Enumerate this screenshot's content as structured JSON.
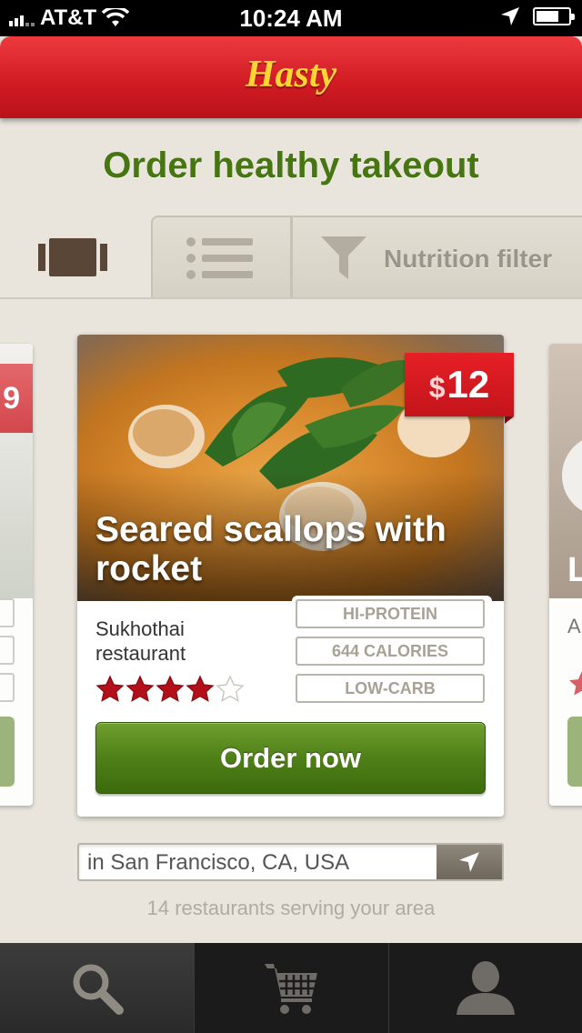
{
  "status_bar": {
    "carrier": "AT&T",
    "time": "10:24 AM"
  },
  "header": {
    "logo": "Hasty"
  },
  "headline": "Order healthy takeout",
  "view_tabs": {
    "filter_label": "Nutrition filter",
    "icons": [
      "card-view-icon",
      "list-view-icon",
      "funnel-icon"
    ]
  },
  "left_card": {
    "price_partial": "9"
  },
  "right_card": {
    "title_partial": "L",
    "restaurant_partial": "A"
  },
  "card": {
    "title": "Seared scallops with rocket",
    "price_currency": "$",
    "price": "12",
    "restaurant": "Sukhothai restaurant",
    "rating": 4,
    "rating_max": 5,
    "badges": [
      "HI-PROTEIN",
      "644 CALORIES",
      "LOW-CARB"
    ],
    "order_button": "Order now"
  },
  "location": {
    "value": "in San Francisco, CA, USA"
  },
  "result_count": "14 restaurants serving your area",
  "tab_bar": {
    "items": [
      "search-icon",
      "cart-icon",
      "profile-icon"
    ],
    "selected": "search-icon"
  },
  "colors": {
    "brand_red": "#d31c24",
    "logo_yellow": "#fbd534",
    "headline_green": "#467512",
    "button_green": "#4f8018",
    "star_red": "#b3101a"
  }
}
